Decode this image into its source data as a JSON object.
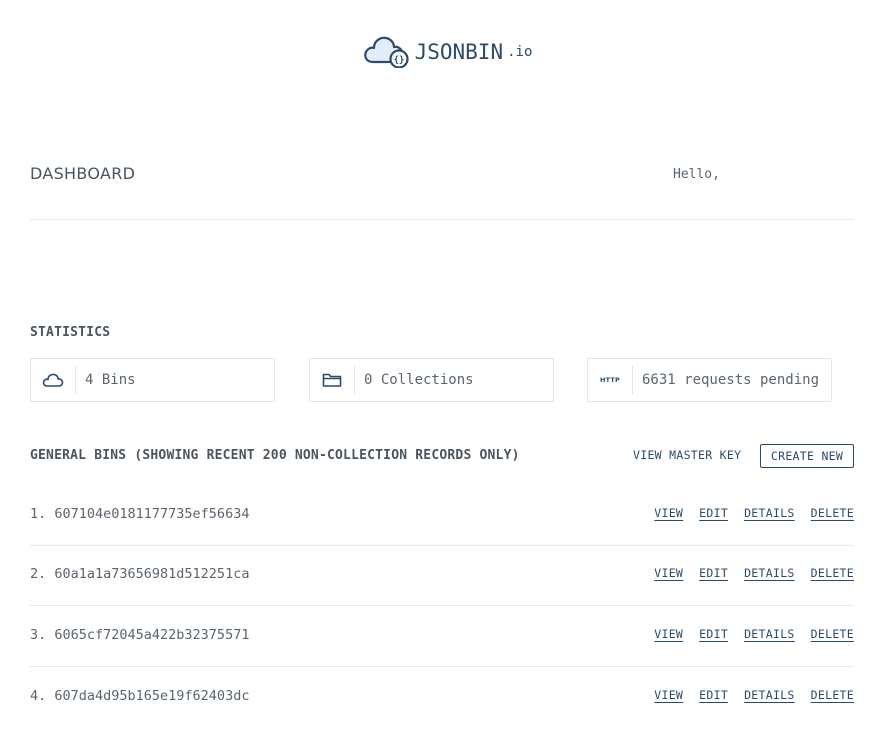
{
  "brand": {
    "name": "JSONBIN",
    "suffix": ".io",
    "icon": "cloud-braces-icon",
    "color": "#2c4a6b"
  },
  "header": {
    "title": "DASHBOARD",
    "greeting": "Hello,"
  },
  "statistics": {
    "title": "STATISTICS",
    "cards": [
      {
        "icon": "cloud-icon",
        "text": "4 Bins"
      },
      {
        "icon": "folder-icon",
        "text": "0 Collections"
      },
      {
        "icon": "http-icon",
        "icon_label": "HTTP",
        "text": "6631 requests pending"
      }
    ]
  },
  "general_bins": {
    "title": "GENERAL BINS (SHOWING RECENT 200 NON-COLLECTION RECORDS ONLY)",
    "view_master_key_label": "VIEW MASTER KEY",
    "create_new_label": "CREATE NEW",
    "actions": {
      "view": "VIEW",
      "edit": "EDIT",
      "details": "DETAILS",
      "delete": "DELETE"
    },
    "items": [
      {
        "label": "1. 607104e0181177735ef56634"
      },
      {
        "label": "2. 60a1a1a73656981d512251ca"
      },
      {
        "label": "3. 6065cf72045a422b32375571"
      },
      {
        "label": "4. 607da4d95b165e19f62403dc"
      }
    ]
  }
}
